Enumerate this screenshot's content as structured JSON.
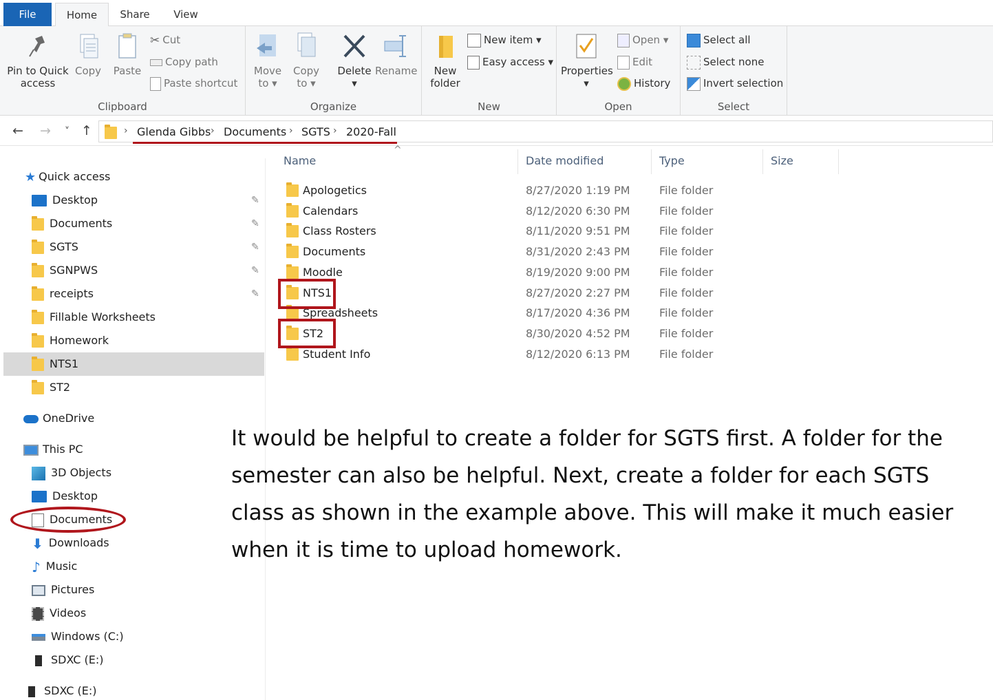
{
  "tabs": {
    "file": "File",
    "home": "Home",
    "share": "Share",
    "view": "View"
  },
  "ribbon": {
    "clipboard": {
      "pin_line1": "Pin to Quick",
      "pin_line2": "access",
      "copy": "Copy",
      "paste": "Paste",
      "cut": "Cut",
      "copy_path": "Copy path",
      "paste_shortcut": "Paste shortcut",
      "label": "Clipboard"
    },
    "organize": {
      "move_line1": "Move",
      "move_line2": "to ▾",
      "copy_line1": "Copy",
      "copy_line2": "to ▾",
      "delete_line1": "Delete",
      "delete_line2": "▾",
      "rename": "Rename",
      "label": "Organize"
    },
    "new": {
      "new_folder_line1": "New",
      "new_folder_line2": "folder",
      "new_item": "New item ▾",
      "easy_access": "Easy access ▾",
      "label": "New"
    },
    "open": {
      "properties_line1": "Properties",
      "properties_line2": "▾",
      "open": "Open ▾",
      "edit": "Edit",
      "history": "History",
      "label": "Open"
    },
    "select": {
      "select_all": "Select all",
      "select_none": "Select none",
      "invert": "Invert selection",
      "label": "Select"
    }
  },
  "address": {
    "back": "←",
    "forward": "→",
    "recent": "˅",
    "up": "↑",
    "crumbs": [
      "Glenda Gibbs",
      "Documents",
      "SGTS",
      "2020-Fall"
    ],
    "sep": "›"
  },
  "sidebar": {
    "quick_access": "Quick access",
    "pinned": [
      "Desktop",
      "Documents",
      "SGTS",
      "SGNPWS",
      "receipts"
    ],
    "recent": [
      "Fillable Worksheets",
      "Homework",
      "NTS1",
      "ST2"
    ],
    "onedrive": "OneDrive",
    "this_pc": "This PC",
    "pc_items": [
      "3D Objects",
      "Desktop",
      "Documents",
      "Downloads",
      "Music",
      "Pictures",
      "Videos",
      "Windows (C:)",
      "SDXC (E:)"
    ],
    "sdxc": "SDXC (E:)",
    "pin_glyph": "✎"
  },
  "columns": {
    "name": "Name",
    "date": "Date modified",
    "type": "Type",
    "size": "Size"
  },
  "files": [
    {
      "name": "Apologetics",
      "date": "8/27/2020 1:19 PM",
      "type": "File folder"
    },
    {
      "name": "Calendars",
      "date": "8/12/2020 6:30 PM",
      "type": "File folder"
    },
    {
      "name": "Class Rosters",
      "date": "8/11/2020 9:51 PM",
      "type": "File folder"
    },
    {
      "name": "Documents",
      "date": "8/31/2020 2:43 PM",
      "type": "File folder"
    },
    {
      "name": "Moodle",
      "date": "8/19/2020 9:00 PM",
      "type": "File folder"
    },
    {
      "name": "NTS1",
      "date": "8/27/2020 2:27 PM",
      "type": "File folder"
    },
    {
      "name": "Spreadsheets",
      "date": "8/17/2020 4:36 PM",
      "type": "File folder"
    },
    {
      "name": "ST2",
      "date": "8/30/2020 4:52 PM",
      "type": "File folder"
    },
    {
      "name": "Student Info",
      "date": "8/12/2020 6:13 PM",
      "type": "File folder"
    }
  ],
  "note": {
    "line1": "It would be helpful to create a folder for SGTS first.  A folder for the",
    "line2": "semester can also be helpful.  Next, create a folder for each SGTS",
    "line3": "class as shown in the example above.  This will make it much easier",
    "line4": "when it is time to upload homework."
  },
  "colors": {
    "accent": "#1a65b5",
    "highlight_red": "#b0161c",
    "folder": "#f7c84a"
  }
}
